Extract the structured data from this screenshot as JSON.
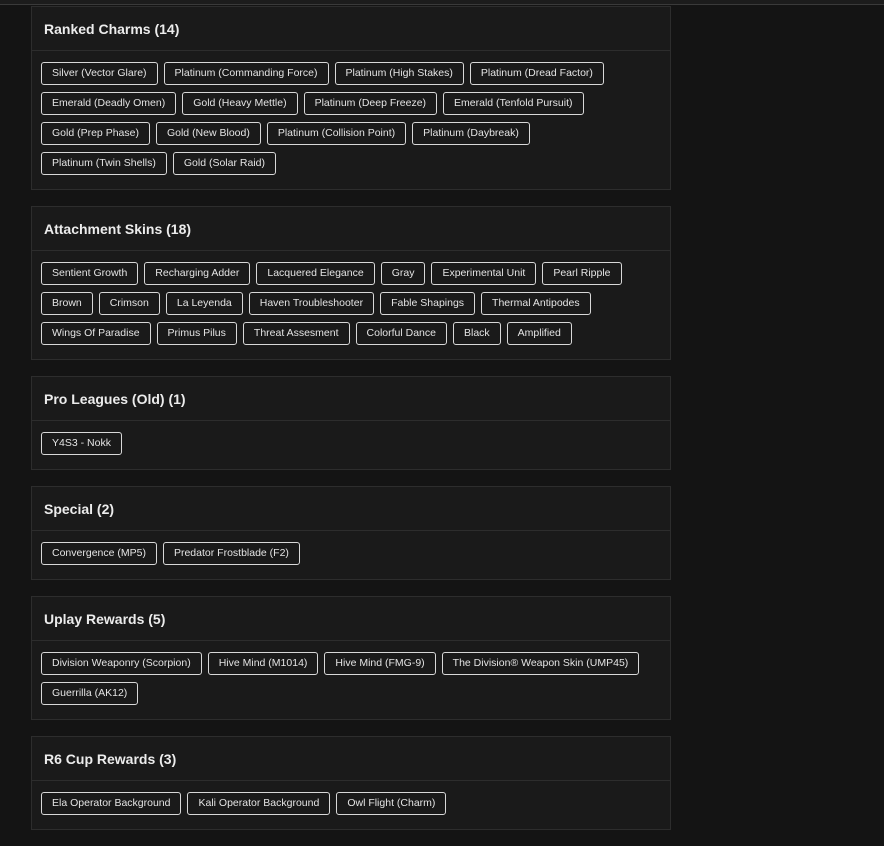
{
  "sections": [
    {
      "title": "Ranked Charms (14)",
      "items": [
        "Silver (Vector Glare)",
        "Platinum (Commanding Force)",
        "Platinum (High Stakes)",
        "Platinum (Dread Factor)",
        "Emerald (Deadly Omen)",
        "Gold (Heavy Mettle)",
        "Platinum (Deep Freeze)",
        "Emerald (Tenfold Pursuit)",
        "Gold (Prep Phase)",
        "Gold (New Blood)",
        "Platinum (Collision Point)",
        "Platinum (Daybreak)",
        "Platinum (Twin Shells)",
        "Gold (Solar Raid)"
      ]
    },
    {
      "title": "Attachment Skins (18)",
      "items": [
        "Sentient Growth",
        "Recharging Adder",
        "Lacquered Elegance",
        "Gray",
        "Experimental Unit",
        "Pearl Ripple",
        "Brown",
        "Crimson",
        "La Leyenda",
        "Haven Troubleshooter",
        "Fable Shapings",
        "Thermal Antipodes",
        "Wings Of Paradise",
        "Primus Pilus",
        "Threat Assesment",
        "Colorful Dance",
        "Black",
        "Amplified"
      ]
    },
    {
      "title": "Pro Leagues (Old) (1)",
      "items": [
        "Y4S3 - Nokk"
      ]
    },
    {
      "title": "Special (2)",
      "items": [
        "Convergence (MP5)",
        "Predator Frostblade (F2)"
      ]
    },
    {
      "title": "Uplay Rewards (5)",
      "items": [
        "Division Weaponry (Scorpion)",
        "Hive Mind (M1014)",
        "Hive Mind (FMG-9)",
        "The Division® Weapon Skin (UMP45)",
        "Guerrilla (AK12)"
      ]
    },
    {
      "title": "R6 Cup Rewards (3)",
      "items": [
        "Ela Operator Background",
        "Kali Operator Background",
        "Owl Flight (Charm)"
      ]
    }
  ]
}
